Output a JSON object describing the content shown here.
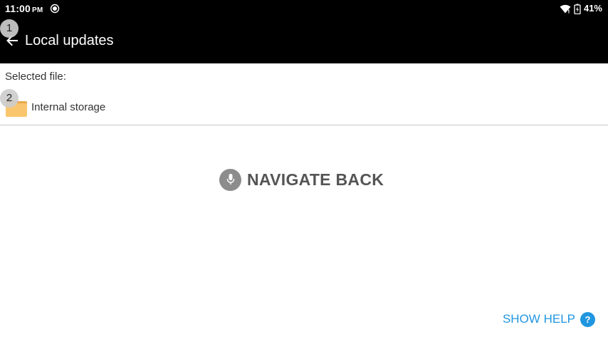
{
  "status_bar": {
    "time": "11:00",
    "ampm": "PM",
    "battery_percent": "41%",
    "icons": [
      "sync-icon",
      "wifi-icon",
      "battery-charging-icon"
    ]
  },
  "toolbar": {
    "title": "Local updates",
    "back_icon": "arrow-left-icon"
  },
  "badges": [
    "1",
    "2"
  ],
  "content": {
    "selected_file_label": "Selected file:",
    "file_row": {
      "icon": "folder-icon",
      "name": "Internal storage"
    }
  },
  "voice_hint": {
    "icon": "mic-icon",
    "text": "NAVIGATE BACK"
  },
  "help": {
    "label": "SHOW HELP",
    "icon_glyph": "?"
  },
  "colors": {
    "toolbar_bg": "#000000",
    "accent": "#2196e0",
    "folder": "#f9c66e",
    "divider": "#c8c8c8"
  }
}
